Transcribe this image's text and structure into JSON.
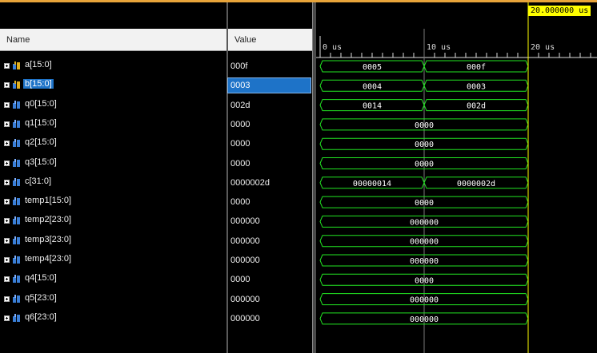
{
  "columns": {
    "name": "Name",
    "value": "Value"
  },
  "cursor": {
    "label": "20.000000 us",
    "time_us": 20
  },
  "ruler": {
    "ticks": [
      {
        "t": 0,
        "label": "0 us"
      },
      {
        "t": 10,
        "label": "10 us"
      },
      {
        "t": 20,
        "label": "20 us"
      }
    ]
  },
  "signals": [
    {
      "name": "a[15:0]",
      "value": "000f",
      "icon": "input-bus-icon",
      "segments": [
        {
          "t0": 0,
          "t1": 10,
          "label": "0005"
        },
        {
          "t0": 10,
          "t1": 20,
          "label": "000f"
        }
      ]
    },
    {
      "name": "b[15:0]",
      "value": "0003",
      "icon": "input-bus-icon",
      "selected": true,
      "segments": [
        {
          "t0": 0,
          "t1": 10,
          "label": "0004"
        },
        {
          "t0": 10,
          "t1": 20,
          "label": "0003"
        }
      ]
    },
    {
      "name": "q0[15:0]",
      "value": "002d",
      "icon": "output-bus-icon",
      "segments": [
        {
          "t0": 0,
          "t1": 10,
          "label": "0014"
        },
        {
          "t0": 10,
          "t1": 20,
          "label": "002d"
        }
      ]
    },
    {
      "name": "q1[15:0]",
      "value": "0000",
      "icon": "output-bus-icon",
      "segments": [
        {
          "t0": 0,
          "t1": 20,
          "label": "0000"
        }
      ]
    },
    {
      "name": "q2[15:0]",
      "value": "0000",
      "icon": "output-bus-icon",
      "segments": [
        {
          "t0": 0,
          "t1": 20,
          "label": "0000"
        }
      ]
    },
    {
      "name": "q3[15:0]",
      "value": "0000",
      "icon": "output-bus-icon",
      "segments": [
        {
          "t0": 0,
          "t1": 20,
          "label": "0000"
        }
      ]
    },
    {
      "name": "c[31:0]",
      "value": "0000002d",
      "icon": "output-bus-icon",
      "segments": [
        {
          "t0": 0,
          "t1": 10,
          "label": "00000014"
        },
        {
          "t0": 10,
          "t1": 20,
          "label": "0000002d"
        }
      ]
    },
    {
      "name": "temp1[15:0]",
      "value": "0000",
      "icon": "output-bus-icon",
      "segments": [
        {
          "t0": 0,
          "t1": 20,
          "label": "0000"
        }
      ]
    },
    {
      "name": "temp2[23:0]",
      "value": "000000",
      "icon": "output-bus-icon",
      "segments": [
        {
          "t0": 0,
          "t1": 20,
          "label": "000000"
        }
      ]
    },
    {
      "name": "temp3[23:0]",
      "value": "000000",
      "icon": "output-bus-icon",
      "segments": [
        {
          "t0": 0,
          "t1": 20,
          "label": "000000"
        }
      ]
    },
    {
      "name": "temp4[23:0]",
      "value": "000000",
      "icon": "output-bus-icon",
      "segments": [
        {
          "t0": 0,
          "t1": 20,
          "label": "000000"
        }
      ]
    },
    {
      "name": "q4[15:0]",
      "value": "0000",
      "icon": "output-bus-icon",
      "segments": [
        {
          "t0": 0,
          "t1": 20,
          "label": "0000"
        }
      ]
    },
    {
      "name": "q5[23:0]",
      "value": "000000",
      "icon": "output-bus-icon",
      "segments": [
        {
          "t0": 0,
          "t1": 20,
          "label": "000000"
        }
      ]
    },
    {
      "name": "q6[23:0]",
      "value": "000000",
      "icon": "output-bus-icon",
      "segments": [
        {
          "t0": 0,
          "t1": 20,
          "label": "000000"
        }
      ]
    }
  ],
  "colors": {
    "wave": "#22e622",
    "cursor": "#ffff00",
    "selected": "#1e73c8",
    "accent": "#e8a43a"
  }
}
